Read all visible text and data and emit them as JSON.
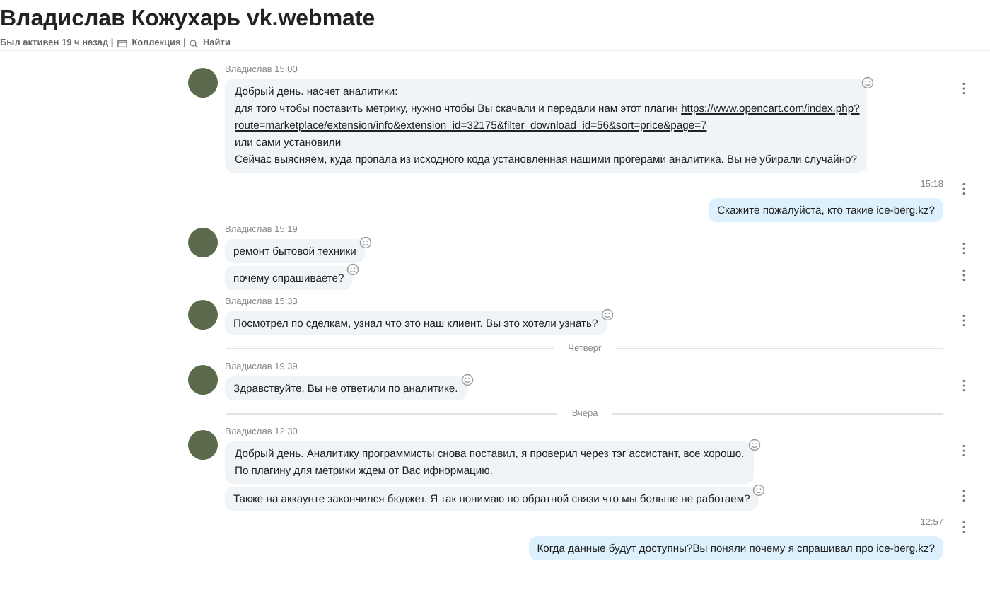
{
  "header": {
    "title": "Владислав Кожухарь vk.webmate",
    "status": "Был активен 19 ч назад |",
    "collection": "Коллекция |",
    "search": "Найти"
  },
  "messages": [
    {
      "kind": "incoming",
      "author": "Владислав",
      "time": "15:00",
      "bubbles": [
        {
          "lines": [
            [
              {
                "text": "Добрый день. насчет аналитики:"
              }
            ],
            [
              {
                "text": "для того чтобы поставить метрику, нужно чтобы Вы скачали и передали нам этот плагин "
              },
              {
                "link": "https://www.opencart.com/index.php?"
              }
            ],
            [
              {
                "link": "route=marketplace/extension/info&extension_id=32175&filter_download_id=56&sort=price&page=7"
              }
            ],
            [
              {
                "text": "или сами установили"
              }
            ],
            [
              {
                "text": "Сейчас выясняем, куда пропала из исходного кода установленная нашими прогерами аналитика. Вы не убирали случайно?"
              }
            ]
          ]
        }
      ]
    },
    {
      "kind": "outgoing",
      "time": "15:18",
      "bubbles": [
        {
          "lines": [
            [
              {
                "text": "Скажите пожалуйста, кто такие ice-berg.kz?"
              }
            ]
          ]
        }
      ]
    },
    {
      "kind": "incoming",
      "author": "Владислав",
      "time": "15:19",
      "bubbles": [
        {
          "lines": [
            [
              {
                "text": "ремонт бытовой техники"
              }
            ]
          ]
        },
        {
          "lines": [
            [
              {
                "text": "почему спрашиваете?"
              }
            ]
          ]
        }
      ]
    },
    {
      "kind": "incoming",
      "author": "Владислав",
      "time": "15:33",
      "bubbles": [
        {
          "lines": [
            [
              {
                "text": "Посмотрел по сделкам, узнал что это наш клиент. Вы это хотели узнать?"
              }
            ]
          ]
        }
      ]
    },
    {
      "kind": "divider",
      "label": "Четверг"
    },
    {
      "kind": "incoming",
      "author": "Владислав",
      "time": "19:39",
      "bubbles": [
        {
          "lines": [
            [
              {
                "text": "Здравствуйте. Вы не ответили по аналитике."
              }
            ]
          ]
        }
      ]
    },
    {
      "kind": "divider",
      "label": "Вчера"
    },
    {
      "kind": "incoming",
      "author": "Владислав",
      "time": "12:30",
      "bubbles": [
        {
          "lines": [
            [
              {
                "text": "Добрый день. Аналитику программисты снова поставил, я проверил через тэг ассистант, все хорошо."
              }
            ],
            [
              {
                "text": "По плагину для метрики ждем от Вас ифнормацию."
              }
            ]
          ]
        },
        {
          "lines": [
            [
              {
                "text": "Также на аккаунте закончился бюджет. Я так понимаю по обратной связи что мы больше не работаем?"
              }
            ]
          ]
        }
      ]
    },
    {
      "kind": "outgoing",
      "time": "12:57",
      "bubbles": [
        {
          "lines": [
            [
              {
                "text": "Когда данные будут доступны?Вы поняли почему я спрашивал про ice-berg.kz?"
              }
            ]
          ]
        }
      ]
    }
  ]
}
